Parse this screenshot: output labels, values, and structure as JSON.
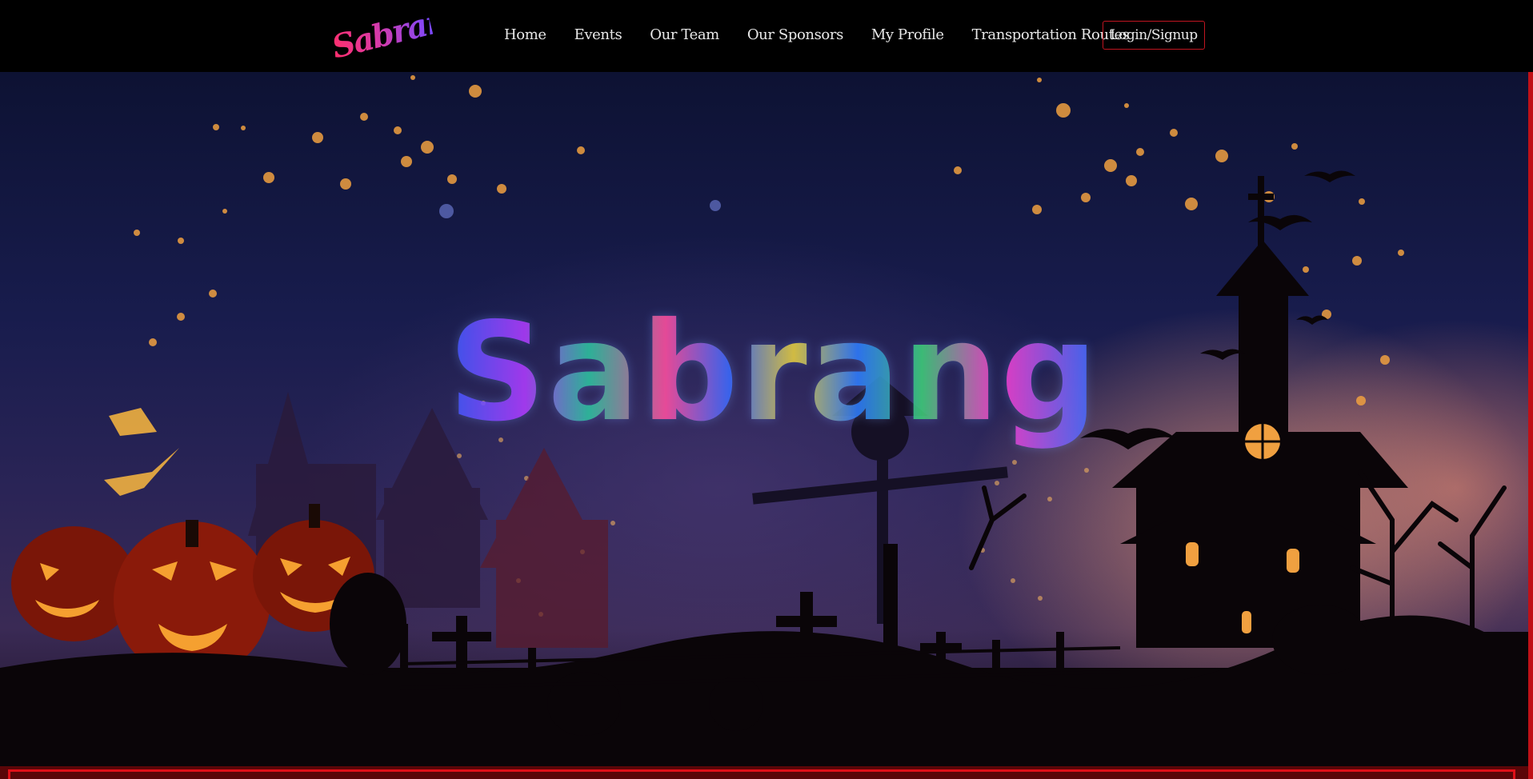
{
  "navbar": {
    "logo_text": "Sabrang",
    "links": [
      {
        "label": "Home"
      },
      {
        "label": "Events"
      },
      {
        "label": "Our Team"
      },
      {
        "label": "Our Sponsors"
      },
      {
        "label": "My Profile"
      },
      {
        "label": "Transportation Routes"
      }
    ],
    "login_label": "Login/Signup"
  },
  "hero": {
    "title": "Sabrang"
  },
  "colors": {
    "accent": "#c01520",
    "nav_text": "#e8e8e8",
    "background": "#000000"
  }
}
